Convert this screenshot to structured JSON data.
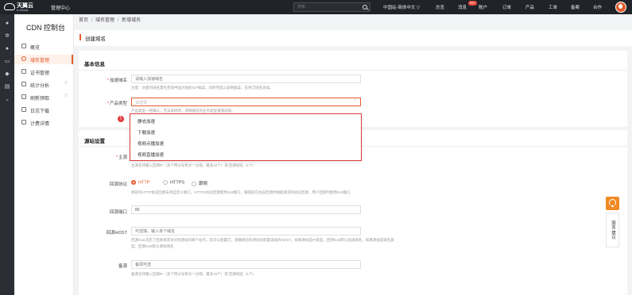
{
  "topbar": {
    "brand": "天翼云",
    "brand_en": "e-Cloud",
    "management": "管理中心",
    "search_placeholder": "搜索",
    "region": "中国站-简体中文 ▽",
    "nav": [
      "总览",
      "消息",
      "账户",
      "订单",
      "产品",
      "工单",
      "备案",
      "合作"
    ],
    "message_badge": "99+"
  },
  "sidebar": {
    "title": "CDN 控制台",
    "items": [
      {
        "label": "概览"
      },
      {
        "label": "域名管理",
        "active": true
      },
      {
        "label": "证书管理"
      },
      {
        "label": "统计分析",
        "arrow": "▽"
      },
      {
        "label": "刷新预取",
        "arrow": "▽"
      },
      {
        "label": "日志下载"
      },
      {
        "label": "计费详情"
      }
    ]
  },
  "breadcrumb": [
    "首页",
    "域名管理",
    "新增域名"
  ],
  "breadcrumb_sep": "/",
  "page_title": "创建域名",
  "basic": {
    "section_title": "基本信息",
    "domain_label": "加速域名",
    "domain_placeholder": "请输入加速域名",
    "domain_hint": "注意：创建的域名需先完成中国大陆的ICP备案，同时完成公安网备案，支持泛域名添加。",
    "type_label": "产品类型",
    "type_placeholder": "请选择",
    "type_hint": "产品类型一经确认，无法再修改，请根据您的业务类型谨慎选择。",
    "dropdown_options": [
      "静态加速",
      "下载加速",
      "视频点播加速",
      "视频直播加速"
    ]
  },
  "origin": {
    "section_title": "源站设置",
    "host_label": "主源",
    "host_hint": "主源支持输入回源IP（多个用分号英文\";\"分隔，最多32个）或 回源域名（1个）",
    "protocol_label": "回源协议",
    "protocol_options": [
      "HTTP",
      "HTTPS",
      "跟随"
    ],
    "protocol_selected": "HTTP",
    "protocol_hint": "目前仅HTTP协议回源支持自定义端口，HTTPS协议回源使用443端口，跟随是在协议回源时根据请求的协议回源，用户回源时使用443端口",
    "port_label": "回源端口",
    "port_value": "80",
    "hostname_label": "回源HOST",
    "hostname_placeholder": "可选填，输入单个域名",
    "hostname_hint1": "回源host决定了回源请求访问到源站的哪个站点，您可以配置它，请确保您的源站有配置该站的HOST。如果源站是IP类型，回源host默认加速域名，如果源站是域名类",
    "hostname_hint2": "型，回源host默认源站域名",
    "backup_label": "备源",
    "backup_placeholder": "备源可选",
    "backup_hint": "备源支持输入回源IP（多个用分号英文\";\"分隔，最多32个）或 回源域名（1个）"
  },
  "help": {
    "feedback": "服务·建议"
  },
  "colors": {
    "accent": "#e35b2a",
    "error": "#e33b3b",
    "topbar_bg": "#212329"
  }
}
